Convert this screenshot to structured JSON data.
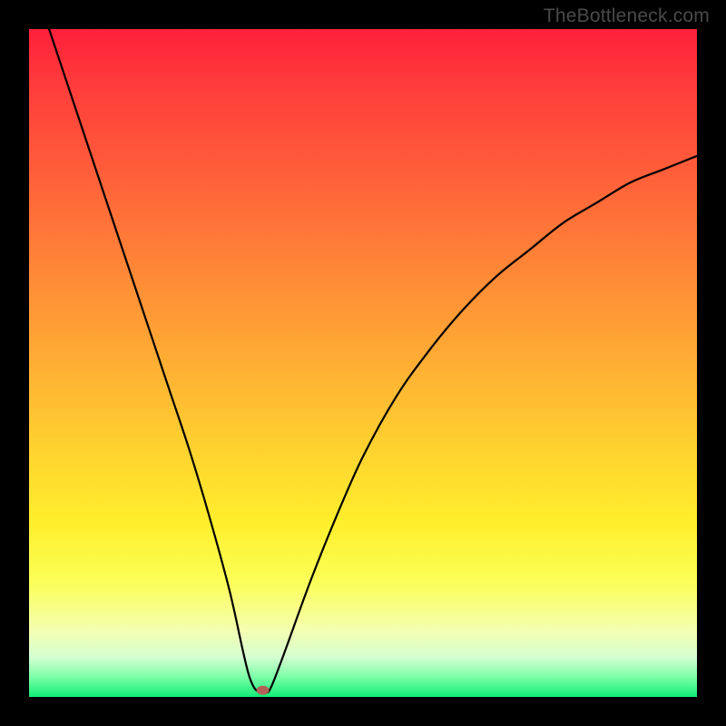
{
  "watermark": "TheBottleneck.com",
  "chart_data": {
    "type": "line",
    "title": "",
    "xlabel": "",
    "ylabel": "",
    "xlim": [
      0,
      100
    ],
    "ylim": [
      0,
      100
    ],
    "x": [
      3,
      6,
      9,
      12,
      15,
      18,
      21,
      24,
      27,
      30,
      32,
      33,
      34,
      35,
      36,
      38,
      42,
      46,
      50,
      55,
      60,
      65,
      70,
      75,
      80,
      85,
      90,
      95,
      100
    ],
    "y": [
      100,
      91,
      82,
      73,
      64,
      55,
      46,
      37,
      27,
      16,
      7,
      3,
      1,
      1,
      1,
      6,
      17,
      27,
      36,
      45,
      52,
      58,
      63,
      67,
      71,
      74,
      77,
      79,
      81
    ],
    "minimum_marker": {
      "x": 35,
      "y": 1,
      "color": "#b46257"
    }
  }
}
